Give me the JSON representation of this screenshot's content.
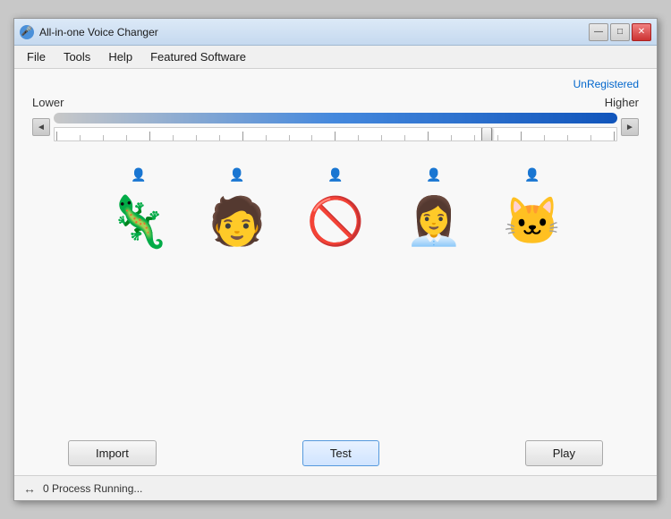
{
  "window": {
    "title": "All-in-one Voice Changer",
    "icon": "🎤",
    "controls": {
      "minimize": "—",
      "maximize": "□",
      "close": "✕"
    }
  },
  "menu": {
    "items": [
      "File",
      "Tools",
      "Help",
      "Featured Software"
    ]
  },
  "status_badge": "UnRegistered",
  "pitch": {
    "lower_label": "Lower",
    "higher_label": "Higher"
  },
  "avatars": [
    {
      "emoji": "🦎",
      "label": "Dragon"
    },
    {
      "emoji": "🧑",
      "label": "Man"
    },
    {
      "emoji": "🚫",
      "label": "None"
    },
    {
      "emoji": "👩‍💼",
      "label": "Woman"
    },
    {
      "emoji": "🐱",
      "label": "Cat"
    }
  ],
  "buttons": {
    "import": "Import",
    "test": "Test",
    "play": "Play"
  },
  "status": {
    "icon": "↔",
    "text": "0 Process Running..."
  }
}
